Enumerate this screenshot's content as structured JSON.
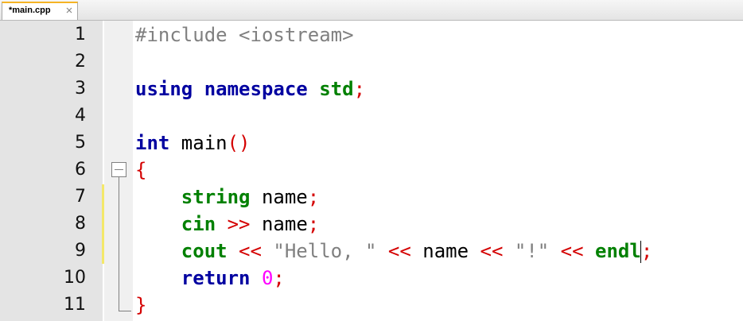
{
  "tabs": [
    {
      "label": "*main.cpp",
      "close_icon": "close-icon"
    }
  ],
  "gutter": {
    "line_numbers": [
      "1",
      "2",
      "3",
      "4",
      "5",
      "6",
      "7",
      "8",
      "9",
      "10",
      "11"
    ]
  },
  "code": {
    "line1": {
      "directive": "#include <iostream>"
    },
    "line3": {
      "using": "using",
      "namespace": "namespace",
      "std": "std",
      "semi": ";"
    },
    "line5": {
      "int": "int",
      "main": " main",
      "parens": "()"
    },
    "line6": {
      "brace": "{"
    },
    "line7": {
      "indent": "    ",
      "string": "string",
      "name": " name",
      "semi": ";"
    },
    "line8": {
      "indent": "    ",
      "cin": "cin",
      "op": " >>",
      "name": " name",
      "semi": ";"
    },
    "line9": {
      "indent": "    ",
      "cout": "cout",
      "op1": " <<",
      "str1": " \"Hello, \"",
      "op2": " <<",
      "name": " name",
      "op3": " <<",
      "str2": " \"!\"",
      "op4": " <<",
      "endl": " endl",
      "semi": ";"
    },
    "line10": {
      "indent": "    ",
      "return": "return",
      "zero": " 0",
      "semi": ";"
    },
    "line11": {
      "brace": "}"
    }
  },
  "colors": {
    "keyword": "#0000a0",
    "type": "#008000",
    "operator": "#d40000",
    "string": "#808080",
    "number": "#ff00ff",
    "change_marker": "#f4e86a",
    "tab_accent": "#f5b324"
  }
}
